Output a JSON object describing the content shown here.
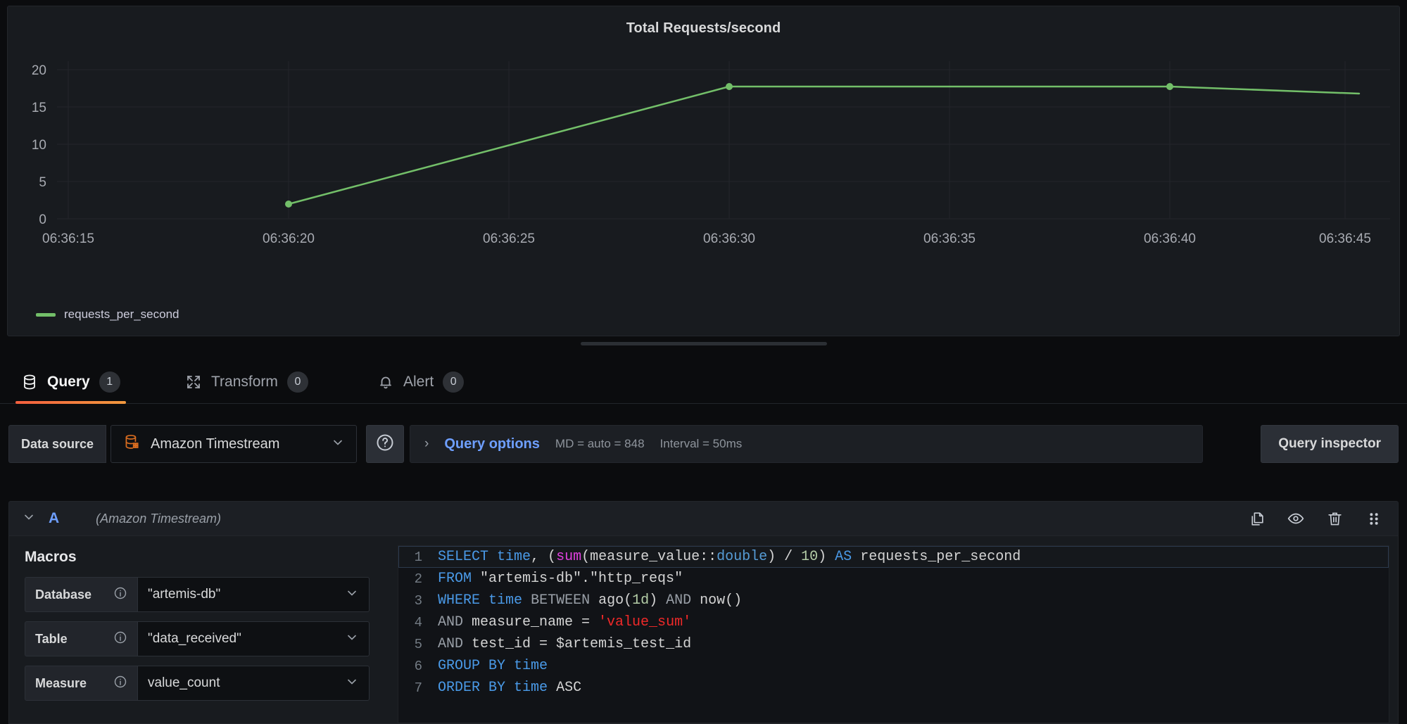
{
  "panel": {
    "title": "Total Requests/second",
    "legend": [
      {
        "label": "requests_per_second",
        "color": "#73bf69"
      }
    ]
  },
  "chart_data": {
    "type": "line",
    "title": "Total Requests/second",
    "xlabel": "",
    "ylabel": "",
    "ylim": [
      0,
      20
    ],
    "yticks": [
      "0",
      "5",
      "10",
      "15",
      "20"
    ],
    "xticks": [
      "06:36:15",
      "06:36:20",
      "06:36:25",
      "06:36:30",
      "06:36:35",
      "06:36:40",
      "06:36:45"
    ],
    "grid": true,
    "legend_position": "bottom-left",
    "series": [
      {
        "name": "requests_per_second",
        "color": "#73bf69",
        "points": [
          {
            "x": "06:36:20",
            "y": 2.0
          },
          {
            "x": "06:36:30",
            "y": 17.8
          },
          {
            "x": "06:36:40",
            "y": 17.8
          },
          {
            "x": "06:36:47",
            "y": 17.0
          }
        ]
      }
    ]
  },
  "tabs": [
    {
      "id": "query",
      "label": "Query",
      "count": "1",
      "icon": "database-icon",
      "active": true
    },
    {
      "id": "transform",
      "label": "Transform",
      "count": "0",
      "icon": "transform-icon",
      "active": false
    },
    {
      "id": "alert",
      "label": "Alert",
      "count": "0",
      "icon": "bell-icon",
      "active": false
    }
  ],
  "toolbar": {
    "data_source_label": "Data source",
    "data_source_value": "Amazon Timestream",
    "help_icon": "question-circle-icon",
    "query_options_label": "Query options",
    "query_options_meta_md": "MD = auto = 848",
    "query_options_meta_interval": "Interval = 50ms",
    "query_inspector_label": "Query inspector"
  },
  "query_row": {
    "ref_id": "A",
    "datasource": "(Amazon Timestream)",
    "actions": [
      {
        "name": "duplicate-query-icon"
      },
      {
        "name": "hide-response-icon"
      },
      {
        "name": "remove-query-icon"
      },
      {
        "name": "drag-handle-icon"
      }
    ]
  },
  "macros": {
    "title": "Macros",
    "rows": [
      {
        "key": "Database",
        "value": "\"artemis-db\""
      },
      {
        "key": "Table",
        "value": "\"data_received\""
      },
      {
        "key": "Measure",
        "value": "value_count"
      }
    ]
  },
  "sql": {
    "lines": [
      {
        "n": "1",
        "tokens": [
          {
            "t": "SELECT",
            "c": "kw"
          },
          {
            "t": " ",
            "c": "plain"
          },
          {
            "t": "time",
            "c": "kw"
          },
          {
            "t": ", (",
            "c": "plain"
          },
          {
            "t": "sum",
            "c": "fn"
          },
          {
            "t": "(measure_value::",
            "c": "plain"
          },
          {
            "t": "double",
            "c": "typ"
          },
          {
            "t": ") / ",
            "c": "plain"
          },
          {
            "t": "10",
            "c": "num"
          },
          {
            "t": ") ",
            "c": "plain"
          },
          {
            "t": "AS",
            "c": "kw"
          },
          {
            "t": " requests_per_second",
            "c": "plain"
          }
        ]
      },
      {
        "n": "2",
        "tokens": [
          {
            "t": "FROM",
            "c": "kw"
          },
          {
            "t": " \"artemis-db\".\"http_reqs\"",
            "c": "plain"
          }
        ]
      },
      {
        "n": "3",
        "tokens": [
          {
            "t": "WHERE",
            "c": "kw"
          },
          {
            "t": " ",
            "c": "plain"
          },
          {
            "t": "time",
            "c": "kw"
          },
          {
            "t": " ",
            "c": "plain"
          },
          {
            "t": "BETWEEN",
            "c": "dim"
          },
          {
            "t": " ago(",
            "c": "plain"
          },
          {
            "t": "1d",
            "c": "num"
          },
          {
            "t": ") ",
            "c": "plain"
          },
          {
            "t": "AND",
            "c": "dim"
          },
          {
            "t": " now()",
            "c": "plain"
          }
        ]
      },
      {
        "n": "4",
        "tokens": [
          {
            "t": "AND",
            "c": "dim"
          },
          {
            "t": " measure_name = ",
            "c": "plain"
          },
          {
            "t": "'value_sum'",
            "c": "str"
          }
        ]
      },
      {
        "n": "5",
        "tokens": [
          {
            "t": "AND",
            "c": "dim"
          },
          {
            "t": " test_id = $artemis_test_id",
            "c": "plain"
          }
        ]
      },
      {
        "n": "6",
        "tokens": [
          {
            "t": "GROUP BY",
            "c": "kw"
          },
          {
            "t": " ",
            "c": "plain"
          },
          {
            "t": "time",
            "c": "kw"
          }
        ]
      },
      {
        "n": "7",
        "tokens": [
          {
            "t": "ORDER BY",
            "c": "kw"
          },
          {
            "t": " ",
            "c": "plain"
          },
          {
            "t": "time",
            "c": "kw"
          },
          {
            "t": " ",
            "c": "plain"
          },
          {
            "t": "ASC",
            "c": "plain"
          }
        ]
      }
    ]
  },
  "colors": {
    "series_green": "#73bf69",
    "accent_blue": "#6e9fff",
    "tab_active_gradient_start": "#f55f3e",
    "tab_active_gradient_end": "#f2993e",
    "panel_bg": "#181b1f",
    "page_bg": "#0b0c0e"
  }
}
